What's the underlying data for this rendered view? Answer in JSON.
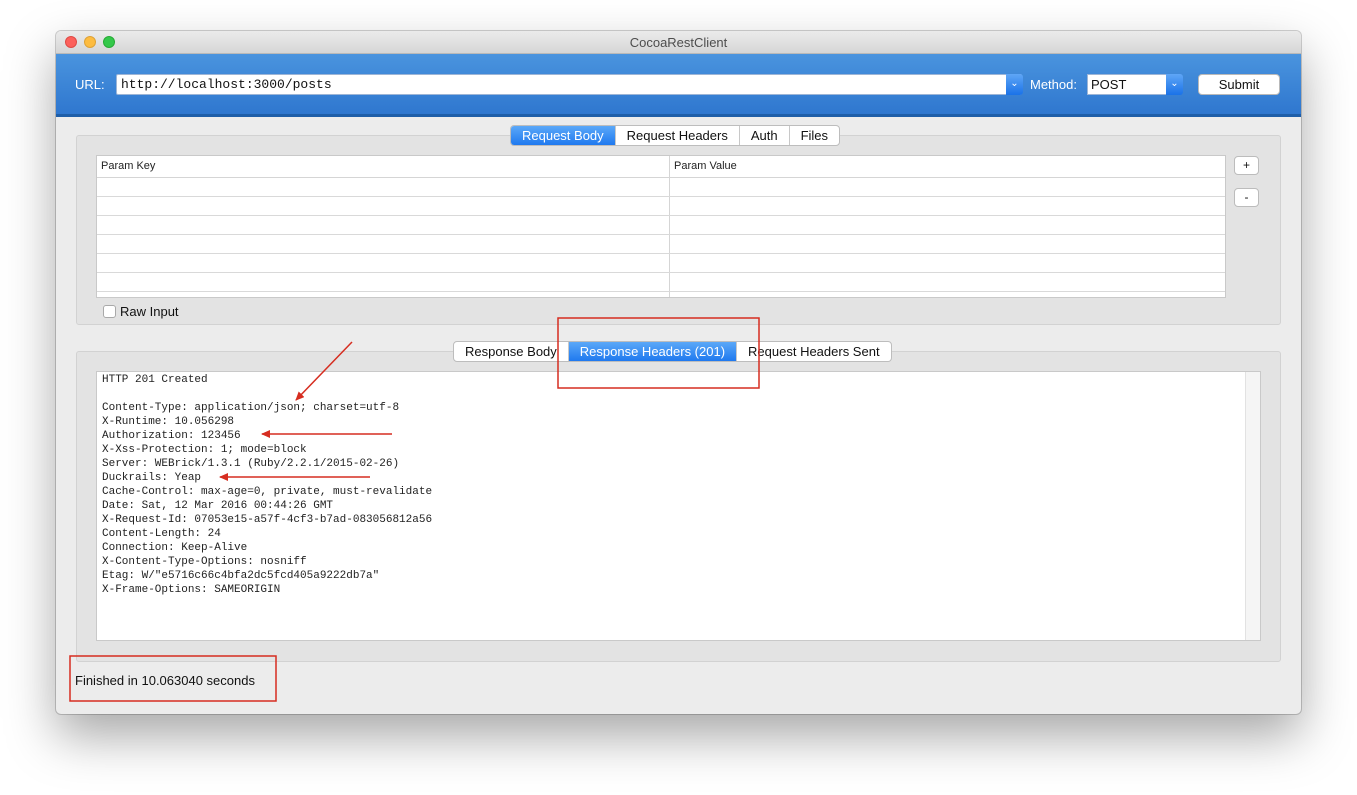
{
  "window": {
    "title": "CocoaRestClient"
  },
  "request": {
    "url_label": "URL:",
    "url_value": "http://localhost:3000/posts",
    "method_label": "Method:",
    "method_value": "POST",
    "submit_label": "Submit"
  },
  "request_tabs": [
    {
      "label": "Request Body",
      "active": true
    },
    {
      "label": "Request Headers",
      "active": false
    },
    {
      "label": "Auth",
      "active": false
    },
    {
      "label": "Files",
      "active": false
    }
  ],
  "params": {
    "headers": [
      "Param Key",
      "Param Value"
    ],
    "add_label": "+",
    "remove_label": "-",
    "raw_input_label": "Raw Input",
    "raw_input_checked": false
  },
  "response_tabs": [
    {
      "label": "Response Body",
      "active": false
    },
    {
      "label": "Response Headers (201)",
      "active": true
    },
    {
      "label": "Request Headers Sent",
      "active": false
    }
  ],
  "response": {
    "lines": [
      "HTTP 201 Created",
      "",
      "Content-Type: application/json; charset=utf-8",
      "X-Runtime: 10.056298",
      "Authorization: 123456",
      "X-Xss-Protection: 1; mode=block",
      "Server: WEBrick/1.3.1 (Ruby/2.2.1/2015-02-26)",
      "Duckrails: Yeap",
      "Cache-Control: max-age=0, private, must-revalidate",
      "Date: Sat, 12 Mar 2016 00:44:26 GMT",
      "X-Request-Id: 07053e15-a57f-4cf3-b7ad-083056812a56",
      "Content-Length: 24",
      "Connection: Keep-Alive",
      "X-Content-Type-Options: nosniff",
      "Etag: W/\"e5716c66c4bfa2dc5fcd405a9222db7a\"",
      "X-Frame-Options: SAMEORIGIN"
    ]
  },
  "status": {
    "text": "Finished in 10.063040 seconds"
  },
  "annotations": {
    "color": "#d62d20"
  }
}
